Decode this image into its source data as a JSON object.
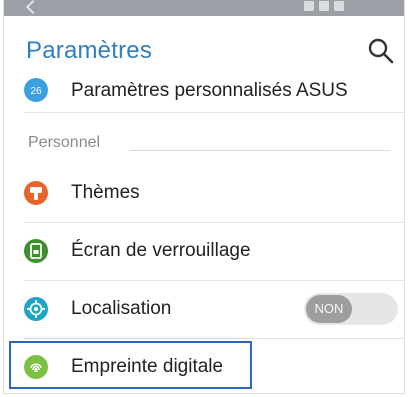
{
  "header": {
    "title": "Paramètres",
    "search_icon": "search-icon"
  },
  "top_item": {
    "label": "Paramètres personnalisés ASUS",
    "icon": "asus-settings-icon",
    "icon_color": "#3aa0de"
  },
  "section": {
    "title": "Personnel"
  },
  "items": [
    {
      "label": "Thèmes",
      "icon": "themes-icon",
      "icon_color": "#e8642a"
    },
    {
      "label": "Écran de verrouillage",
      "icon": "lock-screen-icon",
      "icon_color": "#3f8f2f"
    },
    {
      "label": "Localisation",
      "icon": "location-icon",
      "icon_color": "#1ea6c9",
      "toggle": {
        "state": "NON"
      }
    },
    {
      "label": "Empreinte digitale",
      "icon": "fingerprint-icon",
      "icon_color": "#7cc142"
    }
  ],
  "colors": {
    "accent": "#2f7fbf",
    "highlight": "#2a67b8"
  }
}
